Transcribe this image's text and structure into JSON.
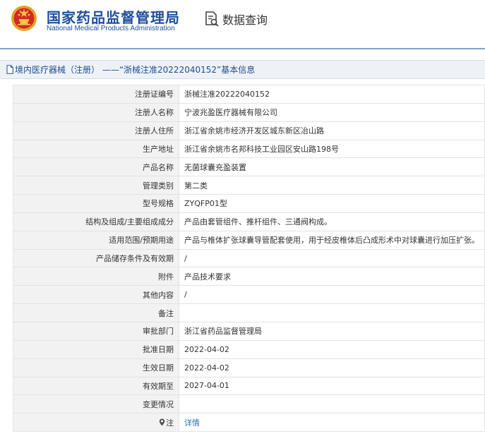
{
  "header": {
    "org_name_cn": "国家药品监督管理局",
    "org_name_en": "National Medical Products Administration",
    "query_label": "数据查询",
    "emblem_icon": "national-emblem-icon",
    "query_icon": "document-search-icon"
  },
  "breadcrumb": {
    "text": "境内医疗器械（注册） ——“浙械注准20222040152”基本信息",
    "icon": "document-icon"
  },
  "details": {
    "rows": [
      {
        "label": "注册证编号",
        "value": "浙械注准20222040152"
      },
      {
        "label": "注册人名称",
        "value": "宁波兆盈医疗器械有限公司"
      },
      {
        "label": "注册人住所",
        "value": "浙江省余姚市经济开发区城东新区冶山路"
      },
      {
        "label": "生产地址",
        "value": "浙江省余姚市名邦科技工业园区安山路198号"
      },
      {
        "label": "产品名称",
        "value": "无菌球囊充盈装置"
      },
      {
        "label": "管理类别",
        "value": "第二类"
      },
      {
        "label": "型号规格",
        "value": "ZYQFP01型"
      },
      {
        "label": "结构及组成/主要组成成分",
        "value": "产品由套管组件、推杆组件、三通阀构成。"
      },
      {
        "label": "适用范围/预期用途",
        "value": "产品与椎体扩张球囊导管配套使用，用于经皮椎体后凸成形术中对球囊进行加压扩张。"
      },
      {
        "label": "产品储存条件及有效期",
        "value": "/"
      },
      {
        "label": "附件",
        "value": "产品技术要求"
      },
      {
        "label": "其他内容",
        "value": "/"
      },
      {
        "label": "备注",
        "value": ""
      },
      {
        "label": "审批部门",
        "value": "浙江省药品监督管理局"
      },
      {
        "label": "批准日期",
        "value": "2022-04-02"
      },
      {
        "label": "生效日期",
        "value": "2022-04-02"
      },
      {
        "label": "有效期至",
        "value": "2027-04-01"
      },
      {
        "label": "变更情况",
        "value": ""
      }
    ],
    "note_label": "注",
    "note_link": "详情",
    "note_icon": "location-pin-icon"
  },
  "colors": {
    "brand_blue": "#1f4f9c",
    "link_blue": "#2c6fb7",
    "label_bg": "#f2f2f2",
    "crumb_bg": "#eef2f7"
  }
}
